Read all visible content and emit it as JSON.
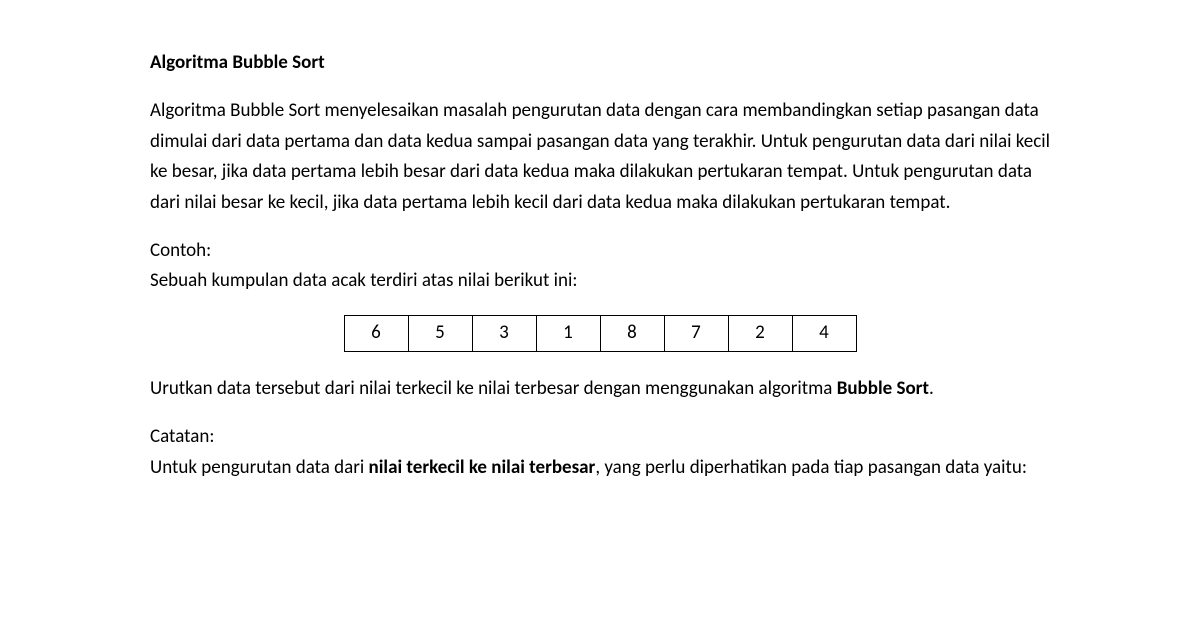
{
  "heading": "Algoritma Bubble Sort",
  "paragraph1": "Algoritma Bubble Sort menyelesaikan masalah pengurutan data dengan cara membandingkan setiap pasangan data dimulai dari data pertama dan data kedua sampai pasangan data yang terakhir. Untuk pengurutan data dari nilai kecil ke besar, jika data pertama lebih besar dari data kedua maka dilakukan pertukaran tempat. Untuk pengurutan data dari nilai besar ke kecil, jika data pertama lebih kecil dari data kedua maka dilakukan pertukaran tempat.",
  "example_label": "Contoh:",
  "example_text": "Sebuah kumpulan data acak terdiri atas nilai berikut ini:",
  "data_values": [
    "6",
    "5",
    "3",
    "1",
    "8",
    "7",
    "2",
    "4"
  ],
  "instruction_part1": "Urutkan data tersebut dari nilai terkecil ke nilai terbesar dengan menggunakan algoritma ",
  "instruction_bold": "Bubble Sort",
  "instruction_part2": ".",
  "note_label": "Catatan:",
  "note_part1": "Untuk pengurutan data dari ",
  "note_bold": "nilai terkecil ke nilai terbesar",
  "note_part2": ", yang perlu diperhatikan pada tiap pasangan data yaitu:"
}
